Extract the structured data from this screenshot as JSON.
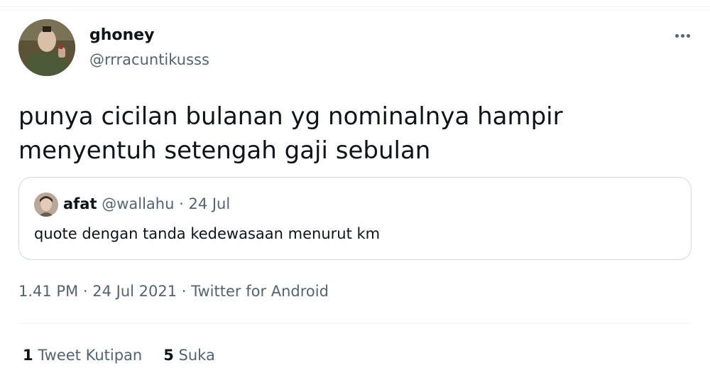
{
  "tweet": {
    "author_name": "ghoney",
    "author_handle": "@rrracuntikusss",
    "text": "punya cicilan bulanan yg nominalnya hampir\nmenyentuh setengah gaji sebulan",
    "timestamp": "1.41 PM",
    "date": "24 Jul 2021",
    "source": "Twitter for Android",
    "separator": " · "
  },
  "quoted_tweet": {
    "author_name": "afat",
    "author_handle": "@wallahu",
    "date": "24 Jul",
    "separator": " · ",
    "text": "quote dengan tanda kedewasaan menurut km"
  },
  "stats": {
    "quotes_count": "1",
    "quotes_label": "Tweet Kutipan",
    "likes_count": "5",
    "likes_label": "Suka"
  },
  "colors": {
    "text_primary": "#0f1419",
    "text_secondary": "#536471",
    "border": "#cfd9de"
  },
  "icons": {
    "more": "more-horizontal-icon"
  }
}
